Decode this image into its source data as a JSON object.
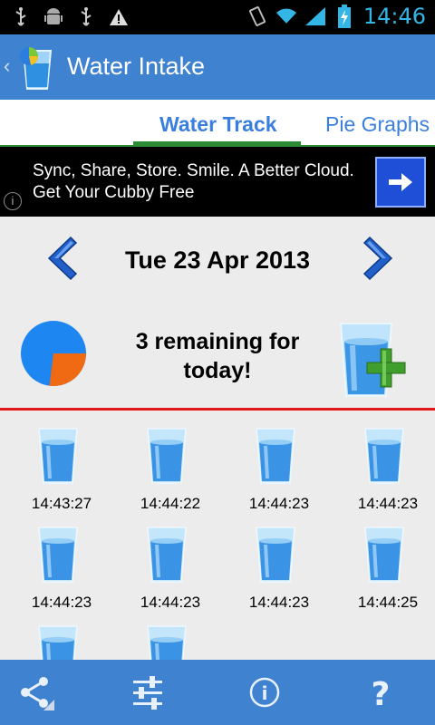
{
  "status_bar": {
    "time": "14:46",
    "icons": [
      "usb-icon",
      "android-debug-icon",
      "usb-icon",
      "warning-icon",
      "vibrate-icon",
      "wifi-icon",
      "signal-icon",
      "battery-charging-icon"
    ]
  },
  "action_bar": {
    "title": "Water Intake",
    "icon": "water-glass-app-icon"
  },
  "tabs": [
    {
      "label": "Water Track",
      "active": true
    },
    {
      "label": "Pie Graphs",
      "active": false
    }
  ],
  "ad": {
    "line1": "Sync, Share, Store. Smile. A Better Cloud.",
    "line2": "Get Your Cubby Free",
    "info_glyph": "i"
  },
  "date": "Tue 23 Apr 2013",
  "summary": {
    "remaining_line1": "3 remaining for",
    "remaining_line2": "today!",
    "pie_fraction_consumed": 0.27
  },
  "entries": [
    {
      "time": "14:43:27"
    },
    {
      "time": "14:44:22"
    },
    {
      "time": "14:44:23"
    },
    {
      "time": "14:44:23"
    },
    {
      "time": "14:44:23"
    },
    {
      "time": "14:44:23"
    },
    {
      "time": "14:44:23"
    },
    {
      "time": "14:44:25"
    },
    {
      "time": ""
    },
    {
      "time": ""
    }
  ],
  "bottom_bar": {
    "share_icon": "share-icon",
    "settings_icon": "sliders-icon",
    "info_glyph": "i",
    "help_glyph": "?"
  },
  "colors": {
    "accent_blue": "#3f82d0",
    "tab_text": "#3a7fe0",
    "tab_indicator": "#2d8a35",
    "divider_red": "#e01818",
    "pie_blue": "#1e86f0",
    "pie_orange": "#f06a14"
  }
}
